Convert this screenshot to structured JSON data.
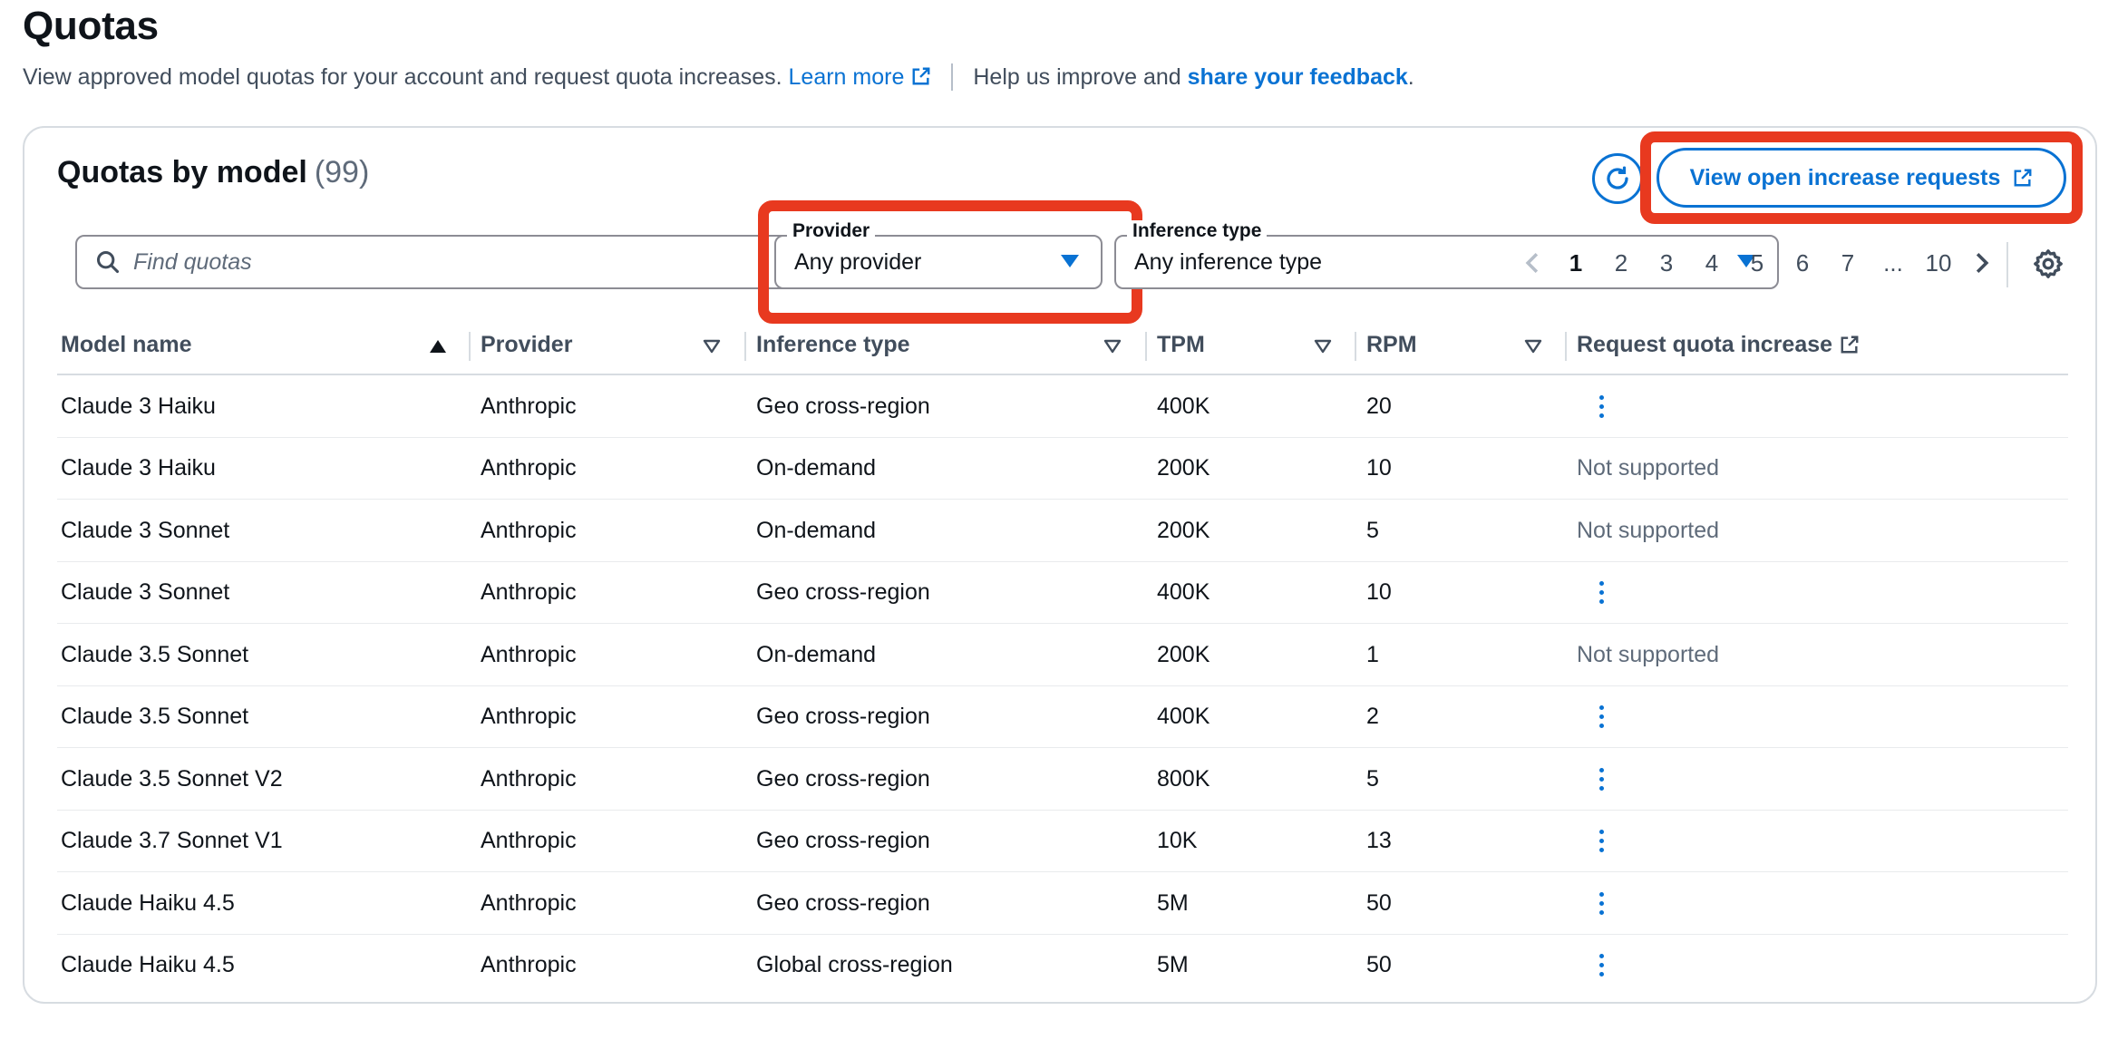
{
  "page": {
    "title": "Quotas",
    "description": "View approved model quotas for your account and request quota increases.",
    "learn_more": "Learn more",
    "help_text": "Help us improve and",
    "feedback_link": "share your feedback",
    "feedback_end": "."
  },
  "card": {
    "title": "Quotas by model",
    "count": "(99)",
    "view_button": "View open increase requests"
  },
  "search": {
    "placeholder": "Find quotas"
  },
  "filters": {
    "provider": {
      "label": "Provider",
      "value": "Any provider"
    },
    "inference": {
      "label": "Inference type",
      "value": "Any inference type"
    }
  },
  "pagination": {
    "pages": [
      "1",
      "2",
      "3",
      "4",
      "5",
      "6",
      "7",
      "...",
      "10"
    ],
    "current": "1"
  },
  "table": {
    "headers": {
      "model": "Model name",
      "provider": "Provider",
      "inference": "Inference type",
      "tpm": "TPM",
      "rpm": "RPM",
      "request": "Request quota increase"
    },
    "rows": [
      {
        "model": "Claude 3 Haiku",
        "provider": "Anthropic",
        "inference": "Geo cross-region",
        "tpm": "400K",
        "rpm": "20",
        "request": ""
      },
      {
        "model": "Claude 3 Haiku",
        "provider": "Anthropic",
        "inference": "On-demand",
        "tpm": "200K",
        "rpm": "10",
        "request": "Not supported"
      },
      {
        "model": "Claude 3 Sonnet",
        "provider": "Anthropic",
        "inference": "On-demand",
        "tpm": "200K",
        "rpm": "5",
        "request": "Not supported"
      },
      {
        "model": "Claude 3 Sonnet",
        "provider": "Anthropic",
        "inference": "Geo cross-region",
        "tpm": "400K",
        "rpm": "10",
        "request": ""
      },
      {
        "model": "Claude 3.5 Sonnet",
        "provider": "Anthropic",
        "inference": "On-demand",
        "tpm": "200K",
        "rpm": "1",
        "request": "Not supported"
      },
      {
        "model": "Claude 3.5 Sonnet",
        "provider": "Anthropic",
        "inference": "Geo cross-region",
        "tpm": "400K",
        "rpm": "2",
        "request": ""
      },
      {
        "model": "Claude 3.5 Sonnet V2",
        "provider": "Anthropic",
        "inference": "Geo cross-region",
        "tpm": "800K",
        "rpm": "5",
        "request": ""
      },
      {
        "model": "Claude 3.7 Sonnet V1",
        "provider": "Anthropic",
        "inference": "Geo cross-region",
        "tpm": "10K",
        "rpm": "13",
        "request": ""
      },
      {
        "model": "Claude Haiku 4.5",
        "provider": "Anthropic",
        "inference": "Geo cross-region",
        "tpm": "5M",
        "rpm": "50",
        "request": ""
      },
      {
        "model": "Claude Haiku 4.5",
        "provider": "Anthropic",
        "inference": "Global cross-region",
        "tpm": "5M",
        "rpm": "50",
        "request": ""
      }
    ]
  },
  "colors": {
    "accent": "#0972d3",
    "highlight": "#e8391f",
    "muted": "#5f6b7a"
  }
}
